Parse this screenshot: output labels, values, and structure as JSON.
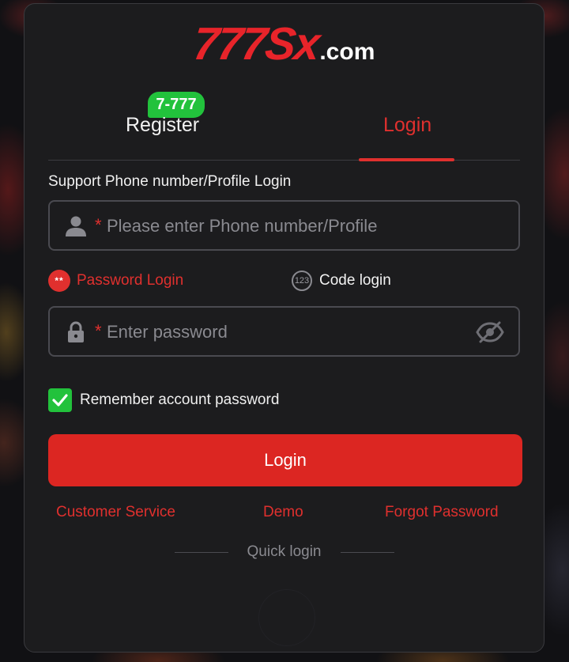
{
  "logo": {
    "main": "777Sx",
    "suffix": ".com"
  },
  "tabs": {
    "register": "Register",
    "register_badge": "7-777",
    "login": "Login"
  },
  "form": {
    "section_label": "Support Phone number/Profile Login",
    "phone": {
      "required_mark": "*",
      "placeholder": "Please enter Phone number/Profile",
      "value": "",
      "icon": "user-icon"
    },
    "login_modes": {
      "password": {
        "label": "Password Login",
        "icon_text": "**"
      },
      "code": {
        "label": "Code login",
        "icon_text": "123"
      }
    },
    "password": {
      "required_mark": "*",
      "placeholder": "Enter password",
      "value": "",
      "icon": "lock-icon",
      "toggle_icon": "eye-off-icon"
    },
    "remember": {
      "label": "Remember account password",
      "checked": true
    },
    "submit_label": "Login"
  },
  "links": {
    "customer_service": "Customer Service",
    "demo": "Demo",
    "forgot_password": "Forgot Password"
  },
  "quick_login_label": "Quick login",
  "colors": {
    "accent": "#e0302e",
    "badge": "#22c23c",
    "panel": "#1c1c1e"
  }
}
